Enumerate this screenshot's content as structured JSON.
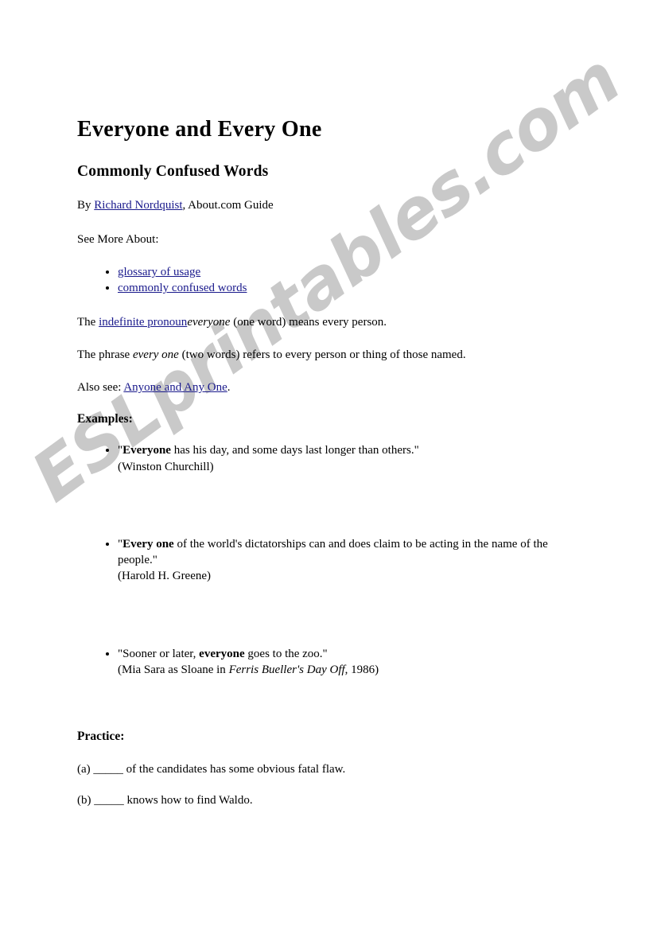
{
  "document": {
    "title": "Everyone and Every One",
    "subtitle": "Commonly Confused Words",
    "byline": {
      "prefix": "By ",
      "author_link": "Richard Nordquist",
      "suffix": ", About.com Guide"
    },
    "see_more_label": "See More About:",
    "see_more_links": [
      "glossary of usage",
      "commonly confused words"
    ],
    "definitions": [
      {
        "before_link": "The ",
        "link": "indefinite pronoun",
        "italic": "everyone",
        "after": " (one word) means every person."
      },
      {
        "before_italic": "The phrase ",
        "italic": "every one",
        "after": " (two words) refers to every person or thing of those named."
      }
    ],
    "also_see": {
      "prefix": "Also see: ",
      "link": "Anyone and Any One",
      "suffix": "."
    },
    "examples_heading": "Examples:",
    "examples": [
      {
        "open_quote": "\"",
        "bold": "Everyone",
        "rest": " has his day, and some days last longer than others.\"",
        "attribution": "(Winston Churchill)"
      },
      {
        "open_quote": "\"",
        "bold": "Every one",
        "rest": " of the world's dictatorships can and does claim to be acting in the name of the people.\"",
        "attribution": "(Harold H. Greene)"
      },
      {
        "open_quote": "\"Sooner or later, ",
        "bold": "everyone",
        "rest": " goes to the zoo.\"",
        "attribution_prefix": "(Mia Sara as Sloane in ",
        "attribution_italic": "Ferris Bueller's Day Off",
        "attribution_suffix": ", 1986)"
      }
    ],
    "practice_heading": "Practice:",
    "practice_items": [
      {
        "label": "(a) ",
        "blank": "_____",
        "text": " of the candidates has some obvious fatal flaw."
      },
      {
        "label": "(b) ",
        "blank": "_____",
        "text": " knows how to find Waldo."
      }
    ]
  },
  "watermark": {
    "text": "ESLprintables.com",
    "color": "#c9c9c9"
  }
}
